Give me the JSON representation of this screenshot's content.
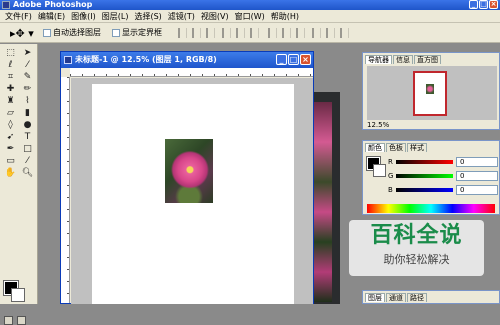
{
  "app": {
    "title": "Adobe Photoshop"
  },
  "menu": [
    "文件(F)",
    "编辑(E)",
    "图像(I)",
    "图层(L)",
    "选择(S)",
    "滤镜(T)",
    "视图(V)",
    "窗口(W)",
    "帮助(H)"
  ],
  "options": {
    "auto_select_label": "自动选择图层",
    "show_bounds_label": "显示定界框"
  },
  "document": {
    "title": "未标题-1 @ 12.5% (图层 1, RGB/8)"
  },
  "navigator": {
    "tabs": [
      "导航器",
      "信息",
      "直方图"
    ],
    "zoom": "12.5%"
  },
  "color_panel": {
    "tabs": [
      "颜色",
      "色板",
      "样式"
    ],
    "channels": [
      {
        "label": "R",
        "value": "0",
        "gradient": "#ff0000"
      },
      {
        "label": "G",
        "value": "0",
        "gradient": "#00ff00"
      },
      {
        "label": "B",
        "value": "0",
        "gradient": "#0000ff"
      }
    ]
  },
  "layers_panel": {
    "tabs": [
      "图层",
      "通道",
      "路径"
    ]
  },
  "watermark": {
    "title": "百科全说",
    "subtitle": "助你轻松解决"
  },
  "colors": {
    "titlebar": "#1f55c9",
    "foreground": "#000000",
    "background": "#ffffff",
    "watermark_green": "#1a8c4a"
  }
}
